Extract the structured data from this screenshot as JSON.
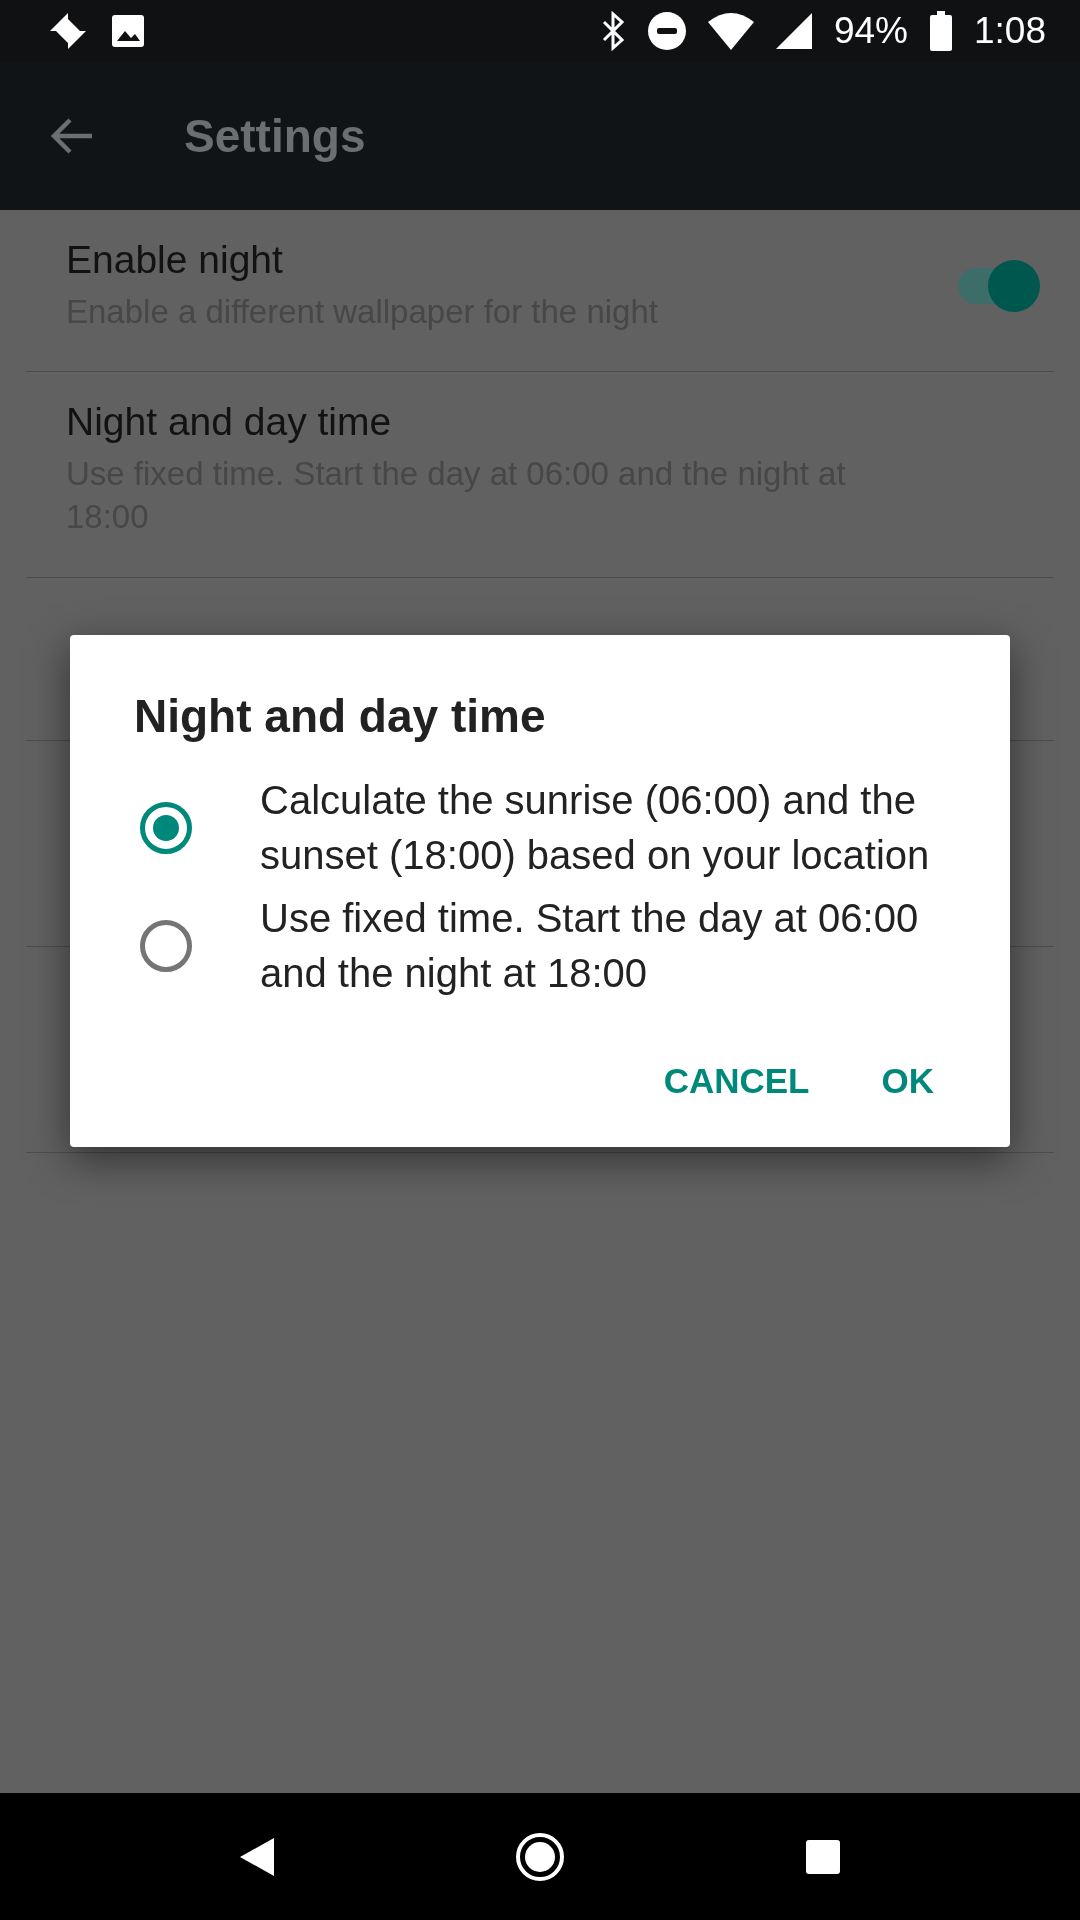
{
  "status_bar": {
    "battery": "94%",
    "time": "1:08"
  },
  "app_bar": {
    "title": "Settings"
  },
  "settings": [
    {
      "kind": "switch",
      "title": "Enable night",
      "subtitle": "Enable a different wallpaper for the night",
      "on": true
    },
    {
      "kind": "text",
      "title": "Night and day time",
      "subtitle": "Use fixed time. Start the day at 06:00 and the night at 18:00"
    }
  ],
  "dialog": {
    "title": "Night and day time",
    "options": [
      {
        "label": "Calculate the sunrise (06:00) and the sunset (18:00) based on your location",
        "selected": true
      },
      {
        "label": "Use fixed time. Start the day at 06:00 and the night at 18:00",
        "selected": false
      }
    ],
    "buttons": [
      "CANCEL",
      "OK"
    ]
  }
}
